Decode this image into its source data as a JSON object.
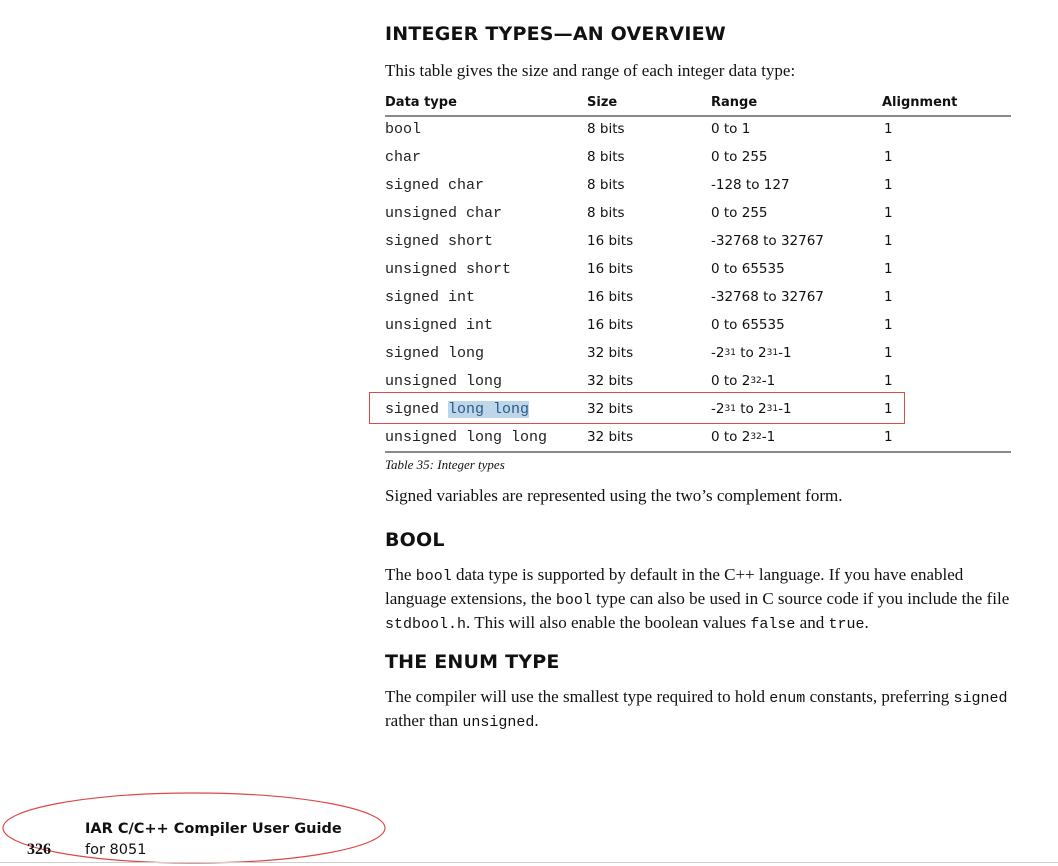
{
  "section1": {
    "heading": "INTEGER TYPES—AN OVERVIEW",
    "intro": "This table gives the size and range of each integer data type:"
  },
  "table": {
    "headers": {
      "type": "Data type",
      "size": "Size",
      "range": "Range",
      "alignment": "Alignment"
    },
    "rows": [
      {
        "type": "bool",
        "size": "8 bits",
        "range": "0 to 1",
        "align": "1"
      },
      {
        "type": "char",
        "size": "8 bits",
        "range": "0 to 255",
        "align": "1"
      },
      {
        "type": "signed char",
        "size": "8 bits",
        "range": "-128 to 127",
        "align": "1"
      },
      {
        "type": "unsigned char",
        "size": "8 bits",
        "range": "0 to 255",
        "align": "1"
      },
      {
        "type": "signed short",
        "size": "16 bits",
        "range": "-32768 to 32767",
        "align": "1"
      },
      {
        "type": "unsigned short",
        "size": "16 bits",
        "range": "0 to 65535",
        "align": "1"
      },
      {
        "type": "signed int",
        "size": "16 bits",
        "range": "-32768 to 32767",
        "align": "1"
      },
      {
        "type": "unsigned int",
        "size": "16 bits",
        "range": "0 to 65535",
        "align": "1"
      },
      {
        "type": "signed long",
        "size": "32 bits",
        "range_a": "-2",
        "range_a_exp": "31",
        "range_mid": " to 2",
        "range_b_exp": "31",
        "range_tail": "-1",
        "align": "1"
      },
      {
        "type": "unsigned long",
        "size": "32 bits",
        "range_a": "0 to 2",
        "range_a_exp": "32",
        "range_tail": "-1",
        "align": "1"
      },
      {
        "type_prefix": "signed ",
        "type_hl": "long long",
        "size": "32 bits",
        "range_a": "-2",
        "range_a_exp": "31",
        "range_mid": " to 2",
        "range_b_exp": "31",
        "range_tail": "-1",
        "align": "1"
      },
      {
        "type": "unsigned long long",
        "size": "32 bits",
        "range_a": "0 to 2",
        "range_a_exp": "32",
        "range_tail": "-1",
        "align": "1"
      }
    ],
    "caption": "Table 35: Integer types"
  },
  "after_table": "Signed variables are represented using the two’s complement form.",
  "bool_section": {
    "heading": "BOOL",
    "t1": "The ",
    "c1": "bool",
    "t2": " data type is supported by default in the C++ language. If you have enabled language extensions, the ",
    "c2": "bool",
    "t3": " type can also be used in C source code if you include the file ",
    "c3": "stdbool.h",
    "t4": ". This will also enable the boolean values ",
    "c4": "false",
    "t5": " and ",
    "c5": "true",
    "t6": "."
  },
  "enum_section": {
    "heading": "THE ENUM TYPE",
    "t1": "The compiler will use the smallest type required to hold ",
    "c1": "enum",
    "t2": " constants, preferring ",
    "c2": "signed",
    "t3": " rather than ",
    "c3": "unsigned",
    "t4": "."
  },
  "footer": {
    "page_number": "326",
    "title": "IAR C/C++ Compiler User Guide",
    "subtitle": "for 8051"
  },
  "colors": {
    "annotation": "#d94a4a",
    "highlight": "#bdd6ea"
  }
}
